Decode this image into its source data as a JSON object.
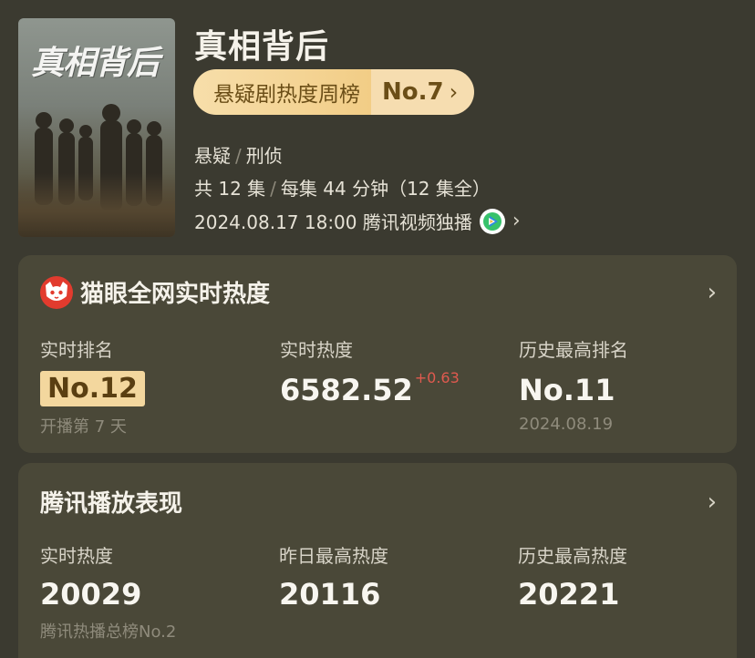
{
  "header": {
    "poster_title": "真相背后",
    "title": "真相背后",
    "rank_board": "悬疑剧热度周榜",
    "rank_value": "No.7",
    "genres": [
      "悬疑",
      "刑侦"
    ],
    "episodes_total": "共 12 集",
    "episode_length": "每集 44 分钟（12 集全）",
    "release": "2024.08.17 18:00 腾讯视频独播",
    "platform_icon": "tencent-video-icon"
  },
  "maoyan": {
    "title": "猫眼全网实时热度",
    "logo_icon": "maoyan-cat-icon",
    "realtime_rank_label": "实时排名",
    "realtime_rank_value": "No.12",
    "realtime_rank_sub": "开播第 7 天",
    "heat_label": "实时热度",
    "heat_value": "6582.52",
    "heat_delta": "+0.63",
    "best_rank_label": "历史最高排名",
    "best_rank_value": "No.11",
    "best_rank_date": "2024.08.19"
  },
  "tencent": {
    "title": "腾讯播放表现",
    "heat_label": "实时热度",
    "heat_value": "20029",
    "heat_sub": "腾讯热播总榜No.2",
    "yesterday_label": "昨日最高热度",
    "yesterday_value": "20116",
    "history_label": "历史最高热度",
    "history_value": "20221"
  },
  "colors": {
    "background": "#3b3a30",
    "card": "#4a4838",
    "gold_badge": "#f3d79e",
    "delta_red": "#e05a4f",
    "maoyan_red": "#e23b2e"
  }
}
